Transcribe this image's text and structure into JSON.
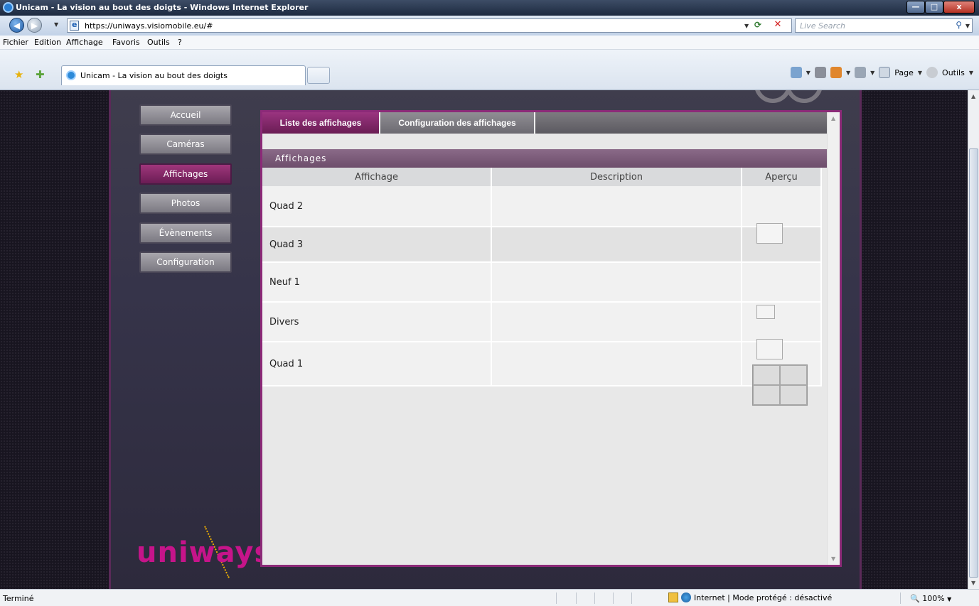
{
  "window": {
    "title": "Unicam - La vision au bout des doigts - Windows Internet Explorer",
    "controls": {
      "minimize": "—",
      "maximize": "□",
      "close": "x"
    }
  },
  "address_bar": {
    "url": "https://uniways.visiomobile.eu/#",
    "search_placeholder": "Live Search"
  },
  "menu": [
    "Fichier",
    "Edition",
    "Affichage",
    "Favoris",
    "Outils",
    "?"
  ],
  "tab": {
    "label": "Unicam - La vision au bout des doigts"
  },
  "command_bar": {
    "page": "Page",
    "tools": "Outils"
  },
  "sidebar": {
    "items": [
      {
        "label": "Accueil",
        "active": false
      },
      {
        "label": "Caméras",
        "active": false
      },
      {
        "label": "Affichages",
        "active": true
      },
      {
        "label": "Photos",
        "active": false
      },
      {
        "label": "Évènements",
        "active": false
      },
      {
        "label": "Configuration",
        "active": false
      }
    ],
    "logo": "uniways"
  },
  "tabs": [
    {
      "label": "Liste des affichages",
      "active": true
    },
    {
      "label": "Configuration des affichages",
      "active": false
    }
  ],
  "section": {
    "title": "Affichages"
  },
  "table": {
    "columns": [
      "Affichage",
      "Description",
      "Aperçu"
    ],
    "rows": [
      {
        "name": "Quad 2",
        "description": "",
        "preview": "single"
      },
      {
        "name": "Quad 3",
        "description": "",
        "preview": "none"
      },
      {
        "name": "Neuf 1",
        "description": "",
        "preview": "single-small"
      },
      {
        "name": "Divers",
        "description": "",
        "preview": "single"
      },
      {
        "name": "Quad 1",
        "description": "",
        "preview": "quad"
      }
    ]
  },
  "status_bar": {
    "text": "Terminé",
    "zone": "Internet | Mode protégé : désactivé",
    "zoom": "100%"
  },
  "colors": {
    "accent": "#8c2a78",
    "active_nav": "#7a2262",
    "section_header": "#7a5a78"
  }
}
